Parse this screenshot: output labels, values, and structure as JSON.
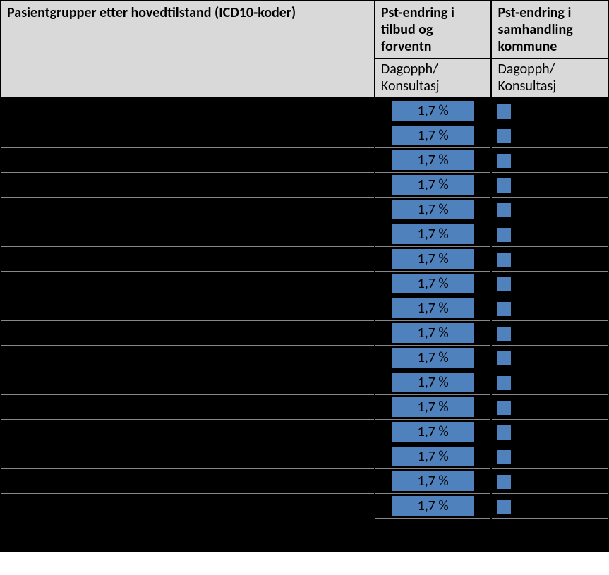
{
  "header": {
    "col1": "Pasientgrupper etter hovedtilstand (ICD10-koder)",
    "col2_top": "Pst-endring i tilbud og forventn",
    "col3_top": "Pst-endring i samhandling kommune",
    "col2_sub": "Dagopph/ Konsultasj",
    "col3_sub": "Dagopph/ Konsultasj"
  },
  "rows": [
    {
      "value1": "1,7 %"
    },
    {
      "value1": "1,7 %"
    },
    {
      "value1": "1,7 %"
    },
    {
      "value1": "1,7 %"
    },
    {
      "value1": "1,7 %"
    },
    {
      "value1": "1,7 %"
    },
    {
      "value1": "1,7 %"
    },
    {
      "value1": "1,7 %"
    },
    {
      "value1": "1,7 %"
    },
    {
      "value1": "1,7 %"
    },
    {
      "value1": "1,7 %"
    },
    {
      "value1": "1,7 %"
    },
    {
      "value1": "1,7 %"
    },
    {
      "value1": "1,7 %"
    },
    {
      "value1": "1,7 %"
    },
    {
      "value1": "1,7 %"
    },
    {
      "value1": "1,7 %"
    }
  ],
  "chart_data": {
    "type": "table",
    "title": "Pasientgrupper etter hovedtilstand (ICD10-koder)",
    "columns": [
      "Pasientgrupper etter hovedtilstand (ICD10-koder)",
      "Pst-endring i tilbud og forventn — Dagopph/Konsultasj",
      "Pst-endring i samhandling kommune — Dagopph/Konsultasj"
    ],
    "rows_count": 17,
    "values_col2_percent": [
      1.7,
      1.7,
      1.7,
      1.7,
      1.7,
      1.7,
      1.7,
      1.7,
      1.7,
      1.7,
      1.7,
      1.7,
      1.7,
      1.7,
      1.7,
      1.7,
      1.7
    ]
  }
}
